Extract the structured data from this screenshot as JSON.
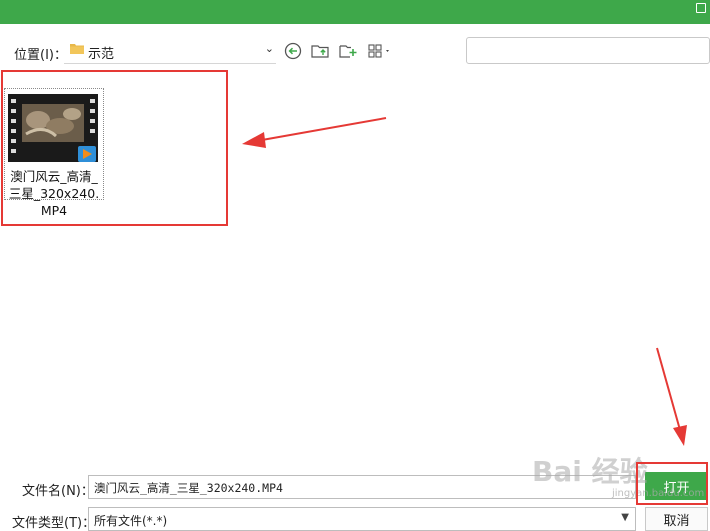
{
  "toolbar": {
    "location_label": "位置(I)：",
    "current_folder": "示范",
    "icons": [
      "back-icon",
      "up-folder-icon",
      "new-folder-icon",
      "view-grid-icon"
    ]
  },
  "files": [
    {
      "name": "澳门风云_高清_三星_320x240.MP4",
      "icon": "video-file-icon"
    }
  ],
  "footer": {
    "filename_label": "文件名(N)：",
    "filename_value": "澳门风云_高清_三星_320x240.MP4",
    "filetype_label": "文件类型(T)：",
    "filetype_value": "所有文件(*.*)",
    "open_label": "打开",
    "cancel_label": "取消"
  },
  "watermark": {
    "main": "Bai 经验",
    "sub": "jingyan.baidu.com"
  },
  "colors": {
    "accent": "#3ea84a",
    "annotation": "#e53935"
  }
}
